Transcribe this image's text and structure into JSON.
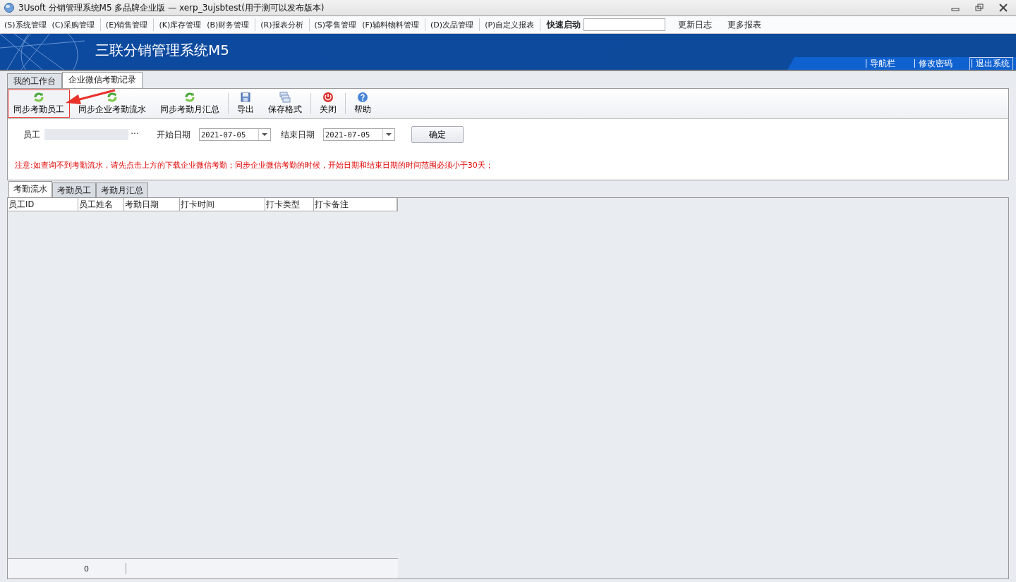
{
  "window": {
    "title": "3Usoft 分销管理系统M5 多品牌企业版 — xerp_3ujsbtest(用于测可以发布版本)"
  },
  "menu": [
    {
      "label": "(S)系统管理",
      "group_end": false
    },
    {
      "label": "(C)采购管理",
      "group_end": true
    },
    {
      "label": "(E)销售管理",
      "group_end": true
    },
    {
      "label": "(K)库存管理",
      "group_end": false
    },
    {
      "label": "(B)财务管理",
      "group_end": true
    },
    {
      "label": "(R)报表分析",
      "group_end": true
    },
    {
      "label": "(S)零售管理",
      "group_end": false
    },
    {
      "label": "(F)辅料物料管理",
      "group_end": true
    },
    {
      "label": "(D)次品管理",
      "group_end": true
    },
    {
      "label": "(P)自定义报表",
      "group_end": true
    }
  ],
  "quick_launch": {
    "label": "快速启动"
  },
  "menu_links": [
    "更新日志",
    "更多报表"
  ],
  "banner": {
    "title": "三联分销管理系统M5",
    "links": [
      {
        "label": "导航栏",
        "selected": false
      },
      {
        "label": "修改密码",
        "selected": false
      },
      {
        "label": "退出系统",
        "selected": true
      }
    ]
  },
  "tabs": [
    {
      "label": "我的工作台",
      "selected": false
    },
    {
      "label": "企业微信考勤记录",
      "selected": true
    }
  ],
  "toolbar": [
    {
      "label": "同步考勤员工",
      "kind": "sync",
      "highlighted": true,
      "group_end": false
    },
    {
      "label": "同步企业考勤流水",
      "kind": "sync",
      "highlighted": false,
      "group_end": false
    },
    {
      "label": "同步考勤月汇总",
      "kind": "sync",
      "highlighted": false,
      "group_end": true
    },
    {
      "label": "导出",
      "kind": "export",
      "highlighted": false,
      "group_end": false
    },
    {
      "label": "保存格式",
      "kind": "layout",
      "highlighted": false,
      "group_end": true
    },
    {
      "label": "关闭",
      "kind": "close",
      "highlighted": false,
      "group_end": true
    },
    {
      "label": "帮助",
      "kind": "help",
      "highlighted": false,
      "group_end": false
    }
  ],
  "filters": {
    "employee_label": "员工",
    "ellipsis": "···",
    "start_label": "开始日期",
    "start_value": "2021-07-05",
    "end_label": "结束日期",
    "end_value": "2021-07-05",
    "confirm": "确定"
  },
  "notice": "注意:如查询不到考勤流水，请先点击上方的下载企业微信考勤；同步企业微信考勤的时候，开始日期和结束日期的时间范围必须小于30天；",
  "sub_tabs": [
    {
      "label": "考勤流水",
      "selected": true
    },
    {
      "label": "考勤员工",
      "selected": false
    },
    {
      "label": "考勤月汇总",
      "selected": false
    }
  ],
  "table": {
    "columns": [
      "员工ID",
      "员工姓名",
      "考勤日期",
      "打卡时间",
      "打卡类型",
      "打卡备注"
    ],
    "footer_count": "0"
  }
}
